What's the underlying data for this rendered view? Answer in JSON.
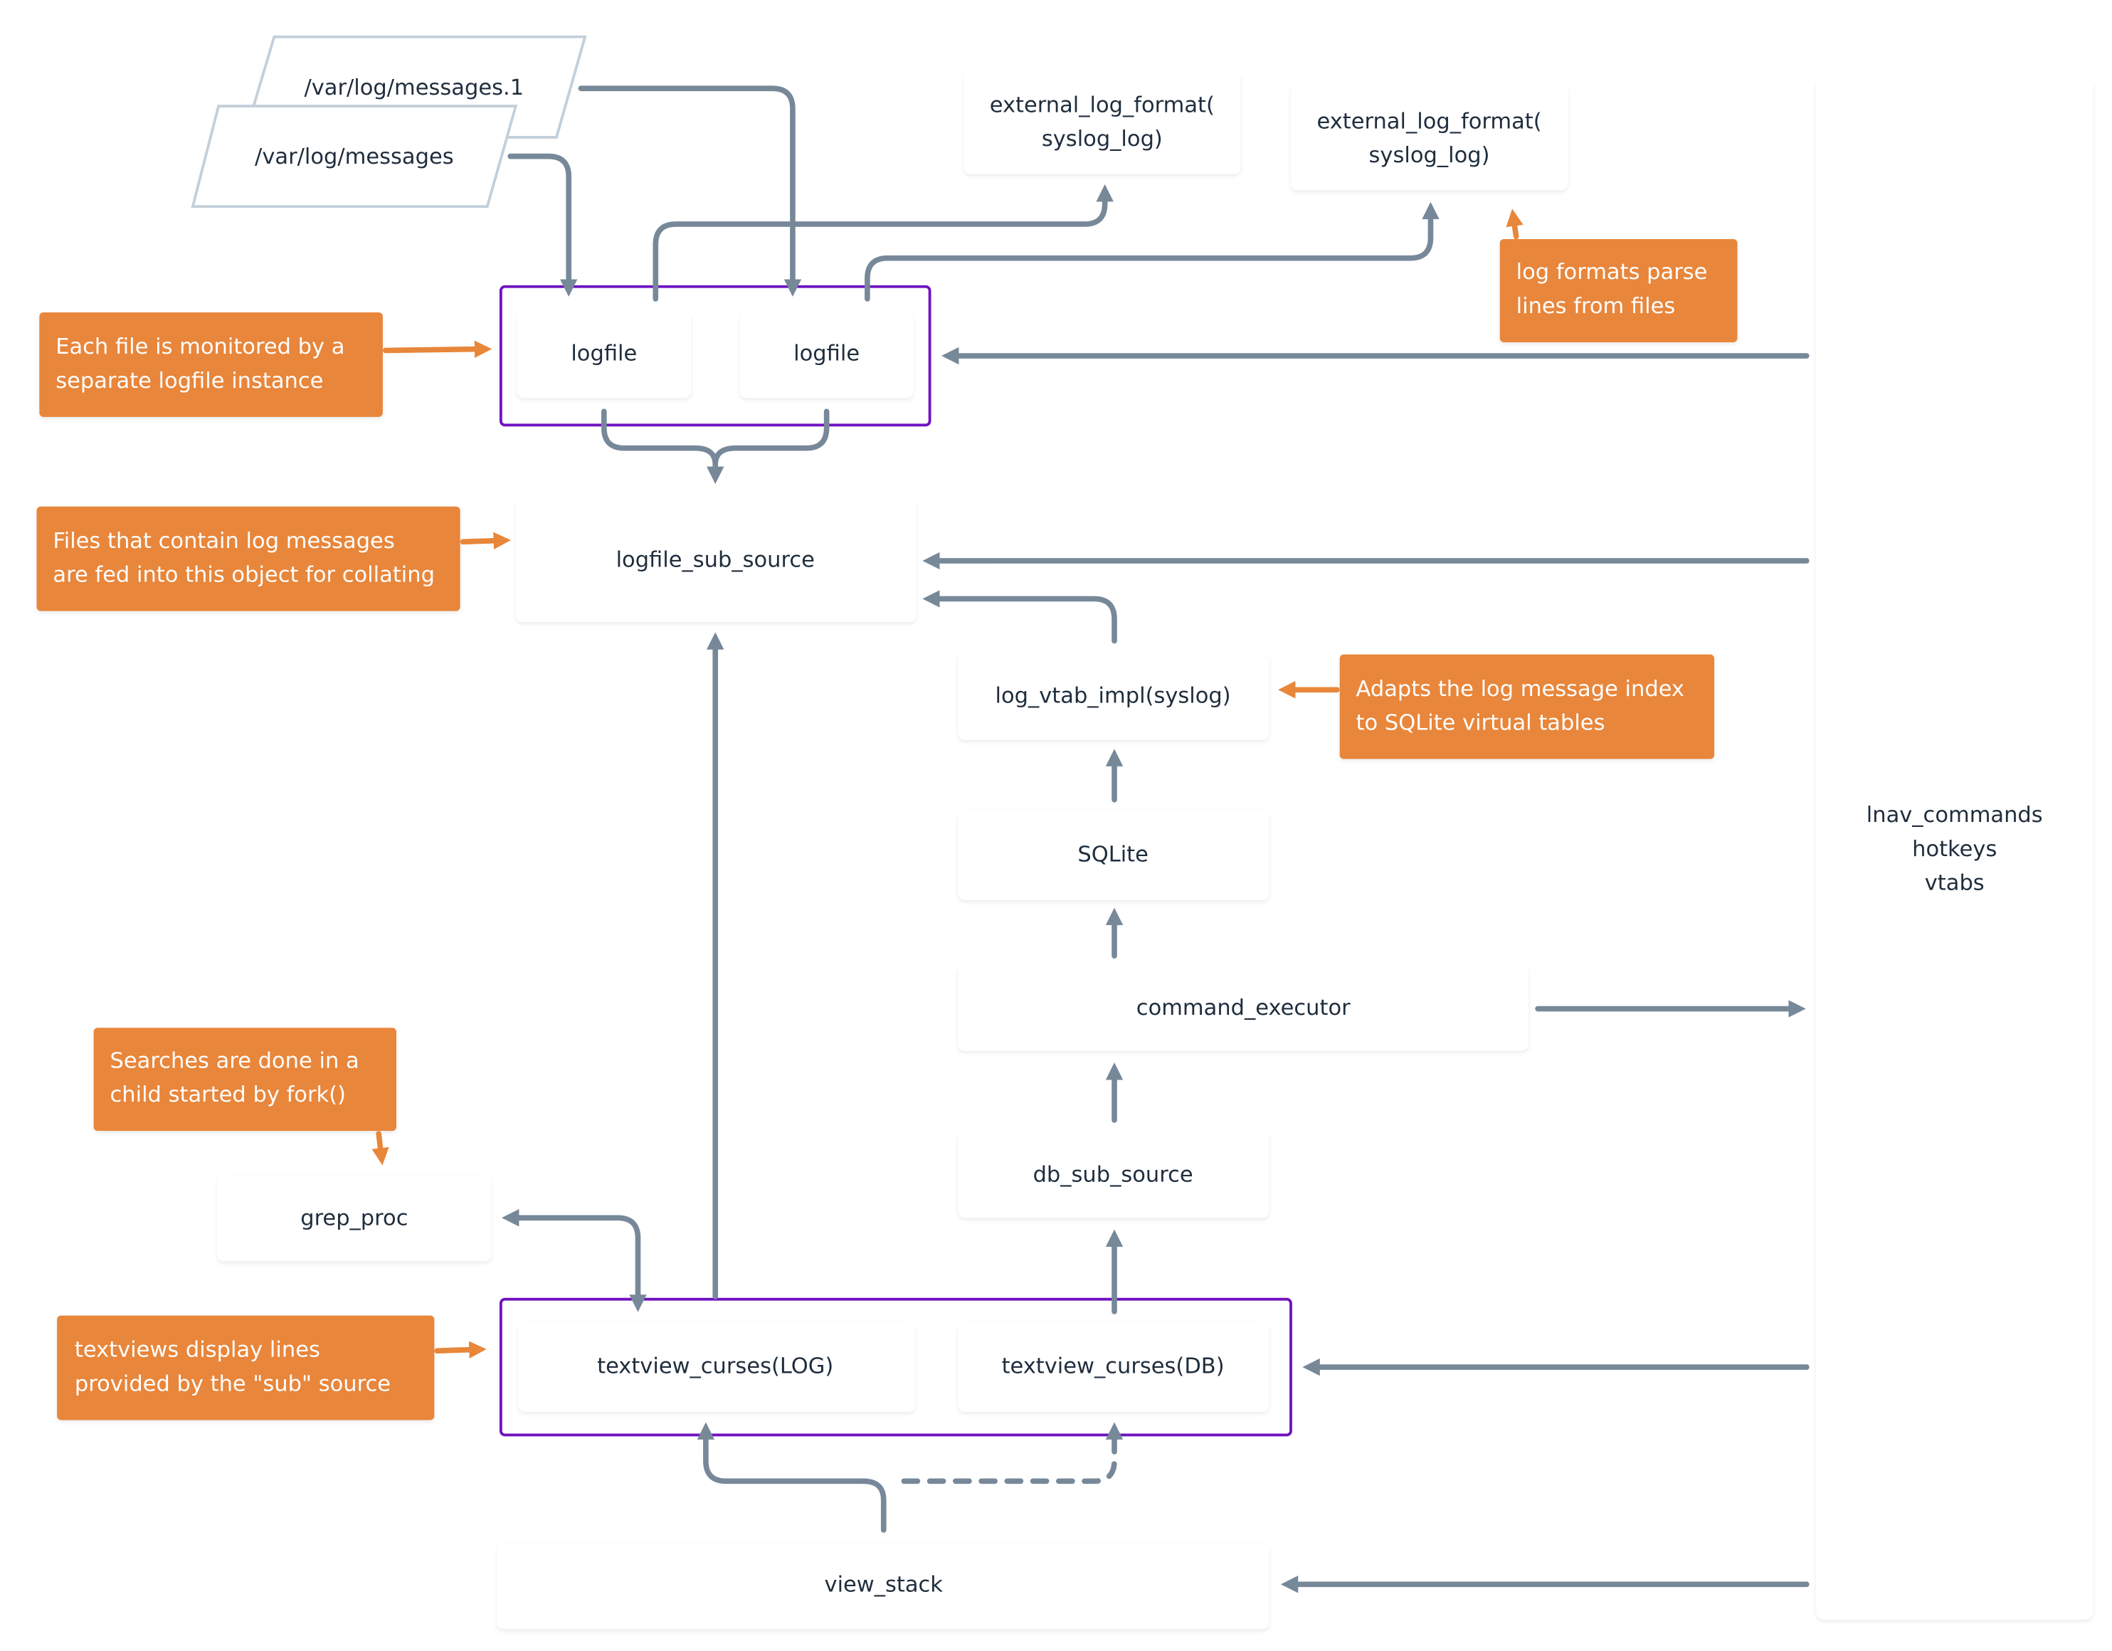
{
  "diagram": {
    "colors": {
      "arrow": "#778899",
      "group_border": "#6f12c0",
      "note_fill": "#e8863a",
      "note_text": "#ffffff",
      "node_text": "#1f2d3d",
      "file_border": "#c3cfd9"
    },
    "files": [
      {
        "id": "messages_1",
        "label": "/var/log/messages.1"
      },
      {
        "id": "messages",
        "label": "/var/log/messages"
      }
    ],
    "nodes": {
      "external_log_format_a": {
        "lines": [
          "external_log_format(",
          "syslog_log)"
        ]
      },
      "external_log_format_b": {
        "lines": [
          "external_log_format(",
          "syslog_log)"
        ]
      },
      "logfile_a": {
        "label": "logfile"
      },
      "logfile_b": {
        "label": "logfile"
      },
      "logfile_sub_source": {
        "label": "logfile_sub_source"
      },
      "log_vtab_impl": {
        "label": "log_vtab_impl(syslog)"
      },
      "sqlite": {
        "label": "SQLite"
      },
      "command_executor": {
        "label": "command_executor"
      },
      "grep_proc": {
        "label": "grep_proc"
      },
      "db_sub_source": {
        "label": "db_sub_source"
      },
      "textview_log": {
        "label": "textview_curses(LOG)"
      },
      "textview_db": {
        "label": "textview_curses(DB)"
      },
      "view_stack": {
        "label": "view_stack"
      },
      "lnav_panel": {
        "lines": [
          "lnav_commands",
          "hotkeys",
          "vtabs"
        ]
      }
    },
    "notes": {
      "logfile_instance": {
        "lines": [
          "Each file is monitored by a",
          "separate logfile instance"
        ]
      },
      "collating": {
        "lines": [
          "Files that contain log messages",
          "are fed into this object for collating"
        ]
      },
      "log_formats": {
        "lines": [
          "log formats parse",
          "lines from files"
        ]
      },
      "vtab": {
        "lines": [
          "Adapts the log message index",
          "to SQLite virtual tables"
        ]
      },
      "searches": {
        "lines": [
          "Searches are done in a",
          "child started by fork()"
        ]
      },
      "textviews": {
        "lines": [
          "textviews display lines",
          "provided by the \"sub\" source"
        ]
      }
    },
    "edges": [
      {
        "from": "/var/log/messages.1",
        "to": "logfile (right)"
      },
      {
        "from": "/var/log/messages",
        "to": "logfile (left)"
      },
      {
        "from": "logfile (left)",
        "to": "external_log_format (left)"
      },
      {
        "from": "logfile (right)",
        "to": "external_log_format (right)"
      },
      {
        "from": "logfile group",
        "to": "logfile_sub_source"
      },
      {
        "from": "lnav_commands panel",
        "to": "logfile group"
      },
      {
        "from": "lnav_commands panel",
        "to": "logfile_sub_source"
      },
      {
        "from": "log_vtab_impl(syslog)",
        "to": "logfile_sub_source"
      },
      {
        "from": "SQLite",
        "to": "log_vtab_impl(syslog)"
      },
      {
        "from": "command_executor",
        "to": "SQLite"
      },
      {
        "from": "command_executor",
        "to": "lnav_commands panel"
      },
      {
        "from": "db_sub_source",
        "to": "command_executor"
      },
      {
        "from": "textview_curses(DB)",
        "to": "db_sub_source"
      },
      {
        "from": "textview_curses(LOG)",
        "to": "logfile_sub_source"
      },
      {
        "from": "textview_curses(LOG)",
        "to": "grep_proc",
        "bidirectional": true
      },
      {
        "from": "lnav_commands panel",
        "to": "textview group"
      },
      {
        "from": "view_stack",
        "to": "textview_curses(LOG)"
      },
      {
        "from": "view_stack",
        "to": "textview_curses(DB)",
        "style": "dashed"
      },
      {
        "from": "lnav_commands panel",
        "to": "view_stack"
      }
    ]
  }
}
